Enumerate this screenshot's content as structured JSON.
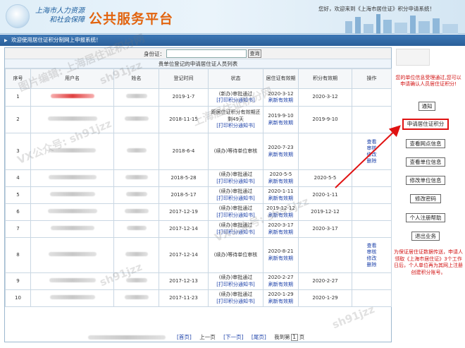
{
  "header": {
    "org_line1": "上海市人力资源",
    "org_line2": "和社会保障",
    "brand_title": "公共服务平台",
    "welcome": "您好，欢迎来到《上海市居住证》积分申请系统！"
  },
  "welcome_bar": "欢迎使用居住证积分制网上申报系统！",
  "search": {
    "label": "身份证：",
    "value": "",
    "button": "查询"
  },
  "list_title": "贵单位登记的申请居住证人员列表",
  "table": {
    "columns": [
      "序号",
      "用户名",
      "姓名",
      "登记时间",
      "状态",
      "居住证有效期",
      "积分有效期",
      "操作"
    ],
    "rows": [
      {
        "no": "1",
        "reg": "2019-1-7",
        "status1": "(新办)审批通过",
        "status2": "[打印积分通知书]",
        "status3": "",
        "residence": "2020-3-12",
        "residence2": "刷新有效期",
        "points": "2020-3-12",
        "ops": []
      },
      {
        "no": "2",
        "reg": "2018-11-15",
        "status1": "距居住证积分有效期还剩49天",
        "status2": "[打印积分通知书]",
        "status3": "",
        "residence": "2019-9-10",
        "residence2": "刷新有效期",
        "points": "2019-9-10",
        "ops": []
      },
      {
        "no": "3",
        "reg": "2018-6-4",
        "status1": "(续办)等待单位审核",
        "status2": "",
        "status3": "",
        "residence": "2020-7-23",
        "residence2": "刷新有效期",
        "points": "",
        "ops": [
          "查看",
          "审核",
          "修改",
          "删除"
        ]
      },
      {
        "no": "4",
        "reg": "2018-5-28",
        "status1": "(续办)审批通过",
        "status2": "[打印积分通知书]",
        "status3": "",
        "residence": "2020-5-5",
        "residence2": "刷新有效期",
        "points": "2020-5-5",
        "ops": []
      },
      {
        "no": "5",
        "reg": "2018-5-17",
        "status1": "(续办)审批通过",
        "status2": "[打印积分通知书]",
        "status3": "",
        "residence": "2020-1-11",
        "residence2": "刷新有效期",
        "points": "2020-1-11",
        "ops": []
      },
      {
        "no": "6",
        "reg": "2017-12-19",
        "status1": "(续办)审批通过",
        "status2": "[打印积分通知书]",
        "status3": "",
        "residence": "2019-12-12",
        "residence2": "刷新有效期",
        "points": "2019-12-12",
        "ops": []
      },
      {
        "no": "7",
        "reg": "2017-12-14",
        "status1": "(续办)审批通过",
        "status2": "[打印积分通知书]",
        "status3": "",
        "residence": "2020-3-17",
        "residence2": "刷新有效期",
        "points": "2020-3-17",
        "ops": []
      },
      {
        "no": "8",
        "reg": "2017-12-14",
        "status1": "(续办)等待单位审核",
        "status2": "",
        "status3": "",
        "residence": "2020-8-21",
        "residence2": "刷新有效期",
        "points": "",
        "ops": [
          "查看",
          "审核",
          "修改",
          "删除"
        ]
      },
      {
        "no": "9",
        "reg": "2017-12-13",
        "status1": "(续办)审批通过",
        "status2": "[打印积分通知书]",
        "status3": "",
        "residence": "2020-2-27",
        "residence2": "刷新有效期",
        "points": "2020-2-27",
        "ops": []
      },
      {
        "no": "10",
        "reg": "2017-11-23",
        "status1": "(续办)审批通过",
        "status2": "[打印积分通知书]",
        "status3": "",
        "residence": "2020-1-29",
        "residence2": "刷新有效期",
        "points": "2020-1-29",
        "ops": []
      }
    ]
  },
  "pager": {
    "first": "[首页]",
    "prev": "上一页",
    "next": "[下一页]",
    "last": "[尾页]",
    "jump_prefix": "我到第",
    "page": "1",
    "jump_suffix": "页"
  },
  "sidebar": {
    "notice": "您的单位信息受理通过,您可以申请确认人员居住证积分!",
    "buttons": [
      "通知",
      "申请居住证积分",
      "查看网点信息",
      "查看单位信息",
      "修改单位信息",
      "修改密码",
      "个人注册帮助",
      "退出业务"
    ],
    "note": "为保证居住证数据传送，申请人领取《上海市居住证》3个工作日后，个人单位再为其网上注册创建积分账号。"
  },
  "watermarks": [
    "sh91jzz",
    "图片编辑: 上海居住证积分网",
    "VX公众号: sh91jzz",
    "上海居住证积分网"
  ],
  "colors": {
    "accent": "#e2640f",
    "bar": "#2a5f99",
    "link": "#1a3fa8",
    "alert": "#d21212"
  }
}
